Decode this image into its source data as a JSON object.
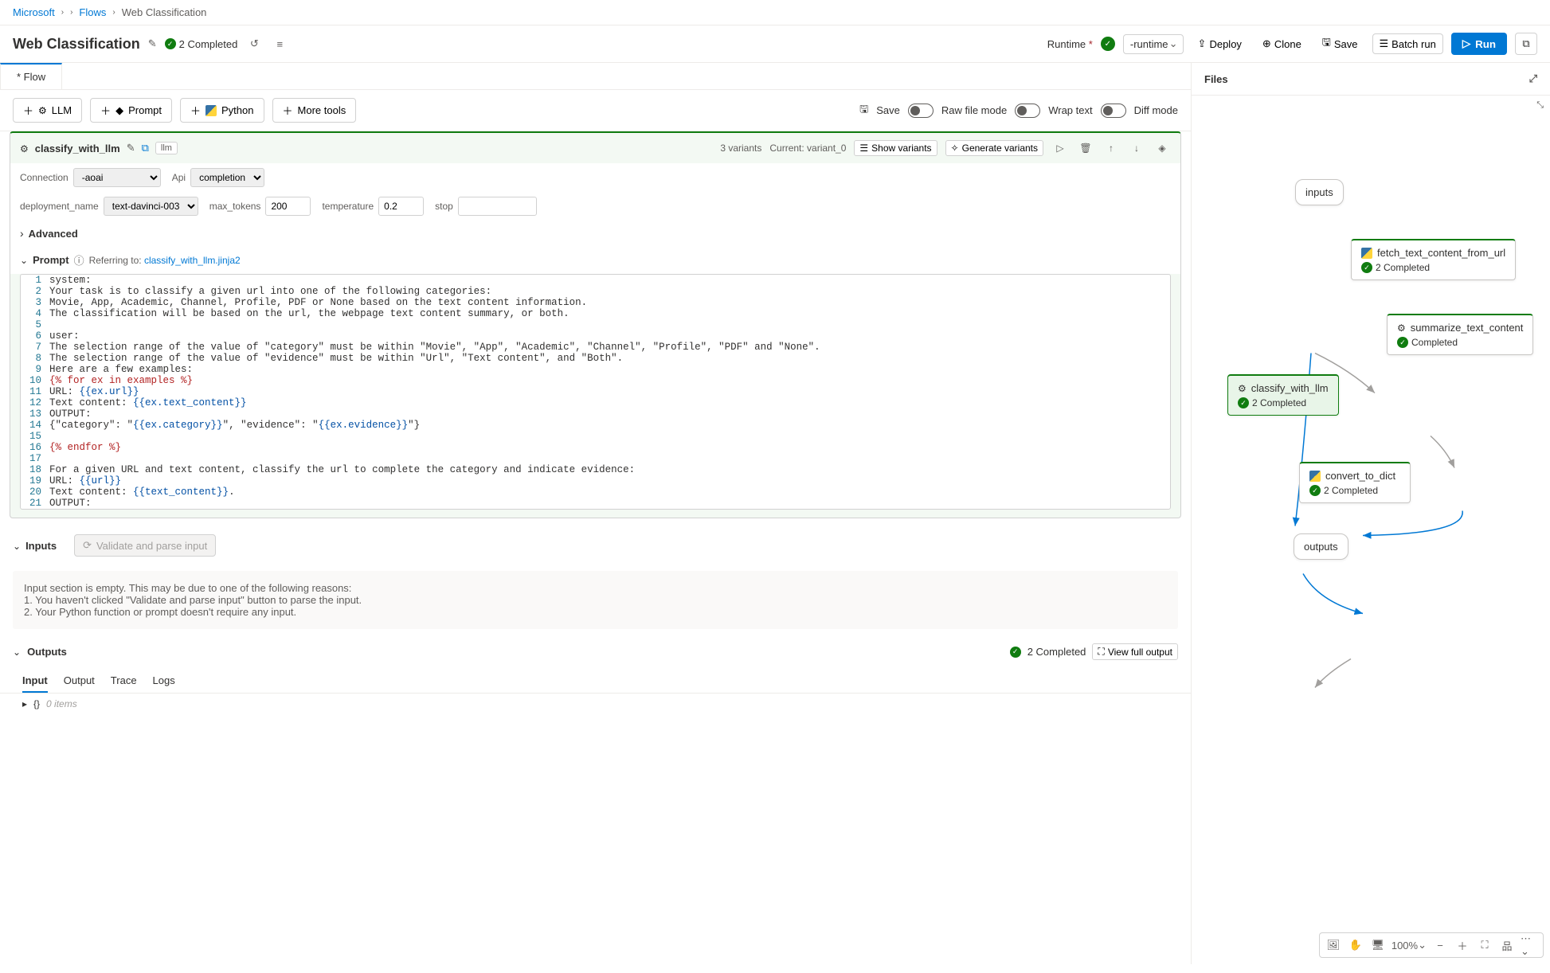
{
  "breadcrumb": {
    "root": "Microsoft",
    "flows": "Flows",
    "current": "Web Classification"
  },
  "page": {
    "title": "Web Classification",
    "status": "2 Completed"
  },
  "runtime": {
    "label": "Runtime",
    "name": "-runtime"
  },
  "actions": {
    "deploy": "Deploy",
    "clone": "Clone",
    "save": "Save",
    "batch": "Batch run",
    "run": "Run"
  },
  "tabs": {
    "flow": "* Flow"
  },
  "toolbar": {
    "llm": "LLM",
    "prompt": "Prompt",
    "python": "Python",
    "more": "More tools",
    "save": "Save",
    "raw": "Raw file mode",
    "wrap": "Wrap text",
    "diff": "Diff mode"
  },
  "node": {
    "name": "classify_with_llm",
    "badge": "llm",
    "variants_count": "3 variants",
    "current_variant": "Current: variant_0",
    "show_variants": "Show variants",
    "generate_variants": "Generate variants",
    "params": {
      "connection_label": "Connection",
      "connection_value": "-aoai",
      "api_label": "Api",
      "api_value": "completion",
      "deployment_label": "deployment_name",
      "deployment_value": "text-davinci-003",
      "max_tokens_label": "max_tokens",
      "max_tokens_value": "200",
      "temperature_label": "temperature",
      "temperature_value": "0.2",
      "stop_label": "stop",
      "stop_value": ""
    },
    "advanced": "Advanced",
    "prompt_label": "Prompt",
    "referring_prefix": "Referring to:",
    "referring_file": "classify_with_llm.jinja2",
    "code": [
      "system:",
      "Your task is to classify a given url into one of the following categories:",
      "Movie, App, Academic, Channel, Profile, PDF or None based on the text content information.",
      "The classification will be based on the url, the webpage text content summary, or both.",
      "",
      "user:",
      "The selection range of the value of \"category\" must be within \"Movie\", \"App\", \"Academic\", \"Channel\", \"Profile\", \"PDF\" and \"None\".",
      "The selection range of the value of \"evidence\" must be within \"Url\", \"Text content\", and \"Both\".",
      "Here are a few examples:",
      "{% for ex in examples %}",
      "URL: {{ex.url}}",
      "Text content: {{ex.text_content}}",
      "OUTPUT:",
      "{\"category\": \"{{ex.category}}\", \"evidence\": \"{{ex.evidence}}\"}",
      "",
      "{% endfor %}",
      "",
      "For a given URL and text content, classify the url to complete the category and indicate evidence:",
      "URL: {{url}}",
      "Text content: {{text_content}}.",
      "OUTPUT:"
    ]
  },
  "inputs": {
    "label": "Inputs",
    "validate_btn": "Validate and parse input",
    "empty_msg_1": "Input section is empty. This may be due to one of the following reasons:",
    "empty_msg_2": "1. You haven't clicked \"Validate and parse input\" button to parse the input.",
    "empty_msg_3": "2. Your Python function or prompt doesn't require any input."
  },
  "outputs": {
    "label": "Outputs",
    "status": "2 Completed",
    "view_full": "View full output",
    "tabs": {
      "input": "Input",
      "output": "Output",
      "trace": "Trace",
      "logs": "Logs"
    },
    "items_text": "0 items"
  },
  "files_panel": {
    "title": "Files"
  },
  "graph": {
    "inputs": "inputs",
    "outputs": "outputs",
    "zoom": "100%",
    "nodes": {
      "n1": {
        "name": "fetch_text_content_from_url",
        "status": "2 Completed",
        "type": "python"
      },
      "n2": {
        "name": "summarize_text_content",
        "status": "Completed",
        "type": "llm"
      },
      "n3": {
        "name": "classify_with_llm",
        "status": "2 Completed",
        "type": "llm"
      },
      "n4": {
        "name": "convert_to_dict",
        "status": "2 Completed",
        "type": "python"
      }
    }
  }
}
